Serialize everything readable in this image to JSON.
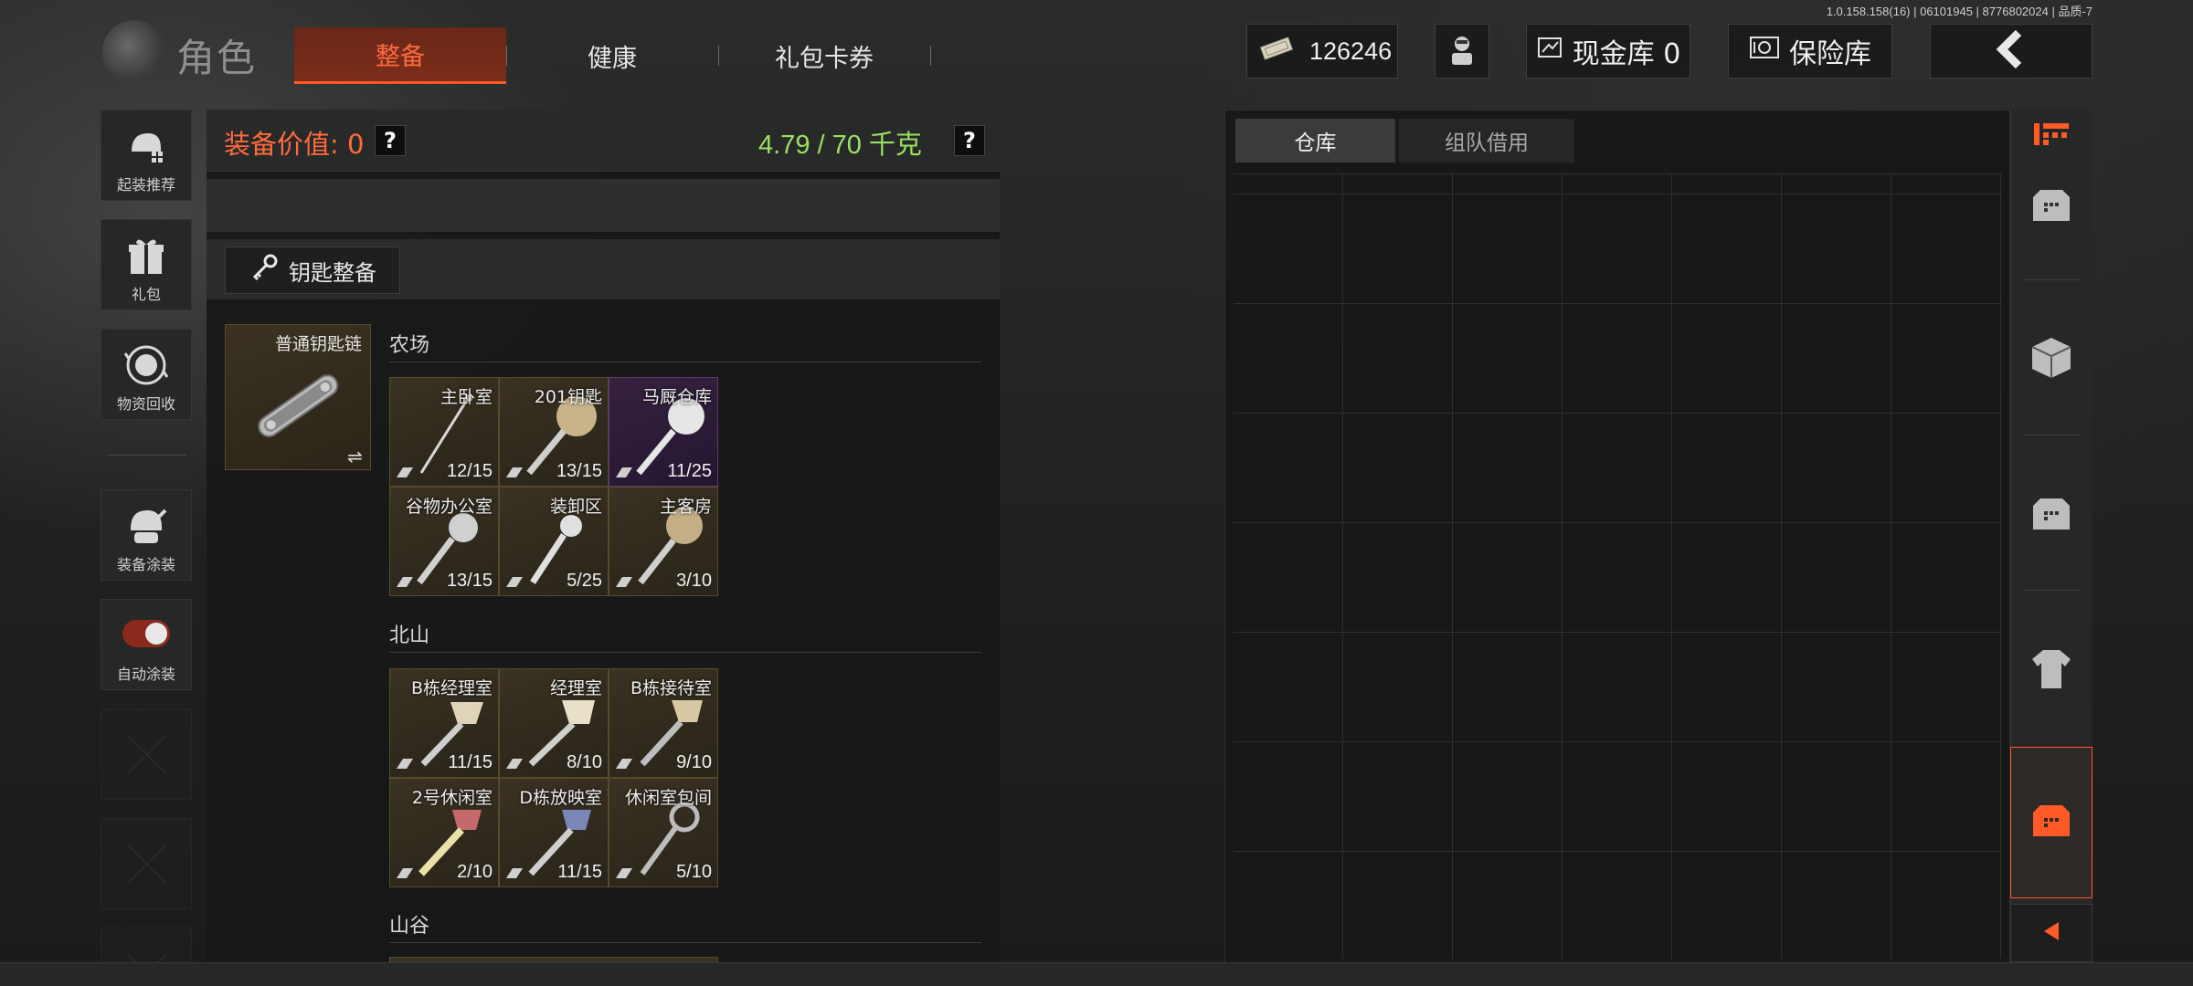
{
  "version": "1.0.158.158(16) | 06101945 | 8776802024 | 品质-7",
  "header": {
    "title": "角色",
    "tabs": [
      {
        "label": "整备",
        "active": true
      },
      {
        "label": "健康",
        "active": false
      },
      {
        "label": "礼包卡券",
        "active": false
      }
    ],
    "money": "126246",
    "cash_vault": "现金库 0",
    "safe": "保险库"
  },
  "sidebar": {
    "items": [
      {
        "label": "起装推荐",
        "icon": "helmet-icon"
      },
      {
        "label": "礼包",
        "icon": "gift-icon"
      },
      {
        "label": "物资回收",
        "icon": "recycle-icon"
      },
      {
        "label": "装备涂装",
        "icon": "paint-helmet-icon"
      },
      {
        "label": "自动涂装",
        "icon": "toggle-icon",
        "toggle_on": true
      }
    ]
  },
  "equipment": {
    "value_label": "装备价值: 0",
    "weight": "4.79 / 70 千克",
    "help": "?",
    "key_button": "钥匙整备",
    "keychain_name": "普通钥匙链",
    "swap": "⇌",
    "groups": [
      {
        "title": "农场",
        "keys": [
          {
            "name": "主卧室",
            "count": "12/15",
            "rarity": "gold"
          },
          {
            "name": "201钥匙",
            "count": "13/15",
            "rarity": "gold"
          },
          {
            "name": "马厩仓库",
            "count": "11/25",
            "rarity": "purple"
          },
          {
            "name": "谷物办公室",
            "count": "13/15",
            "rarity": "gold"
          },
          {
            "name": "装卸区",
            "count": "5/25",
            "rarity": "gold"
          },
          {
            "name": "主客房",
            "count": "3/10",
            "rarity": "gold"
          }
        ]
      },
      {
        "title": "北山",
        "keys": [
          {
            "name": "B栋经理室",
            "count": "11/15",
            "rarity": "gold"
          },
          {
            "name": "经理室",
            "count": "8/10",
            "rarity": "gold"
          },
          {
            "name": "B栋接待室",
            "count": "9/10",
            "rarity": "gold"
          },
          {
            "name": "2号休闲室",
            "count": "2/10",
            "rarity": "gold"
          },
          {
            "name": "D栋放映室",
            "count": "11/15",
            "rarity": "gold"
          },
          {
            "name": "休闲室包间",
            "count": "5/10",
            "rarity": "gold"
          }
        ]
      },
      {
        "title": "山谷",
        "keys": []
      }
    ]
  },
  "warehouse": {
    "tabs": [
      {
        "label": "仓库",
        "active": true
      },
      {
        "label": "组队借用",
        "active": false
      }
    ]
  },
  "colors": {
    "accent": "#ff5a28",
    "weight_green": "#9be062",
    "value_orange": "#ff6a3d"
  }
}
